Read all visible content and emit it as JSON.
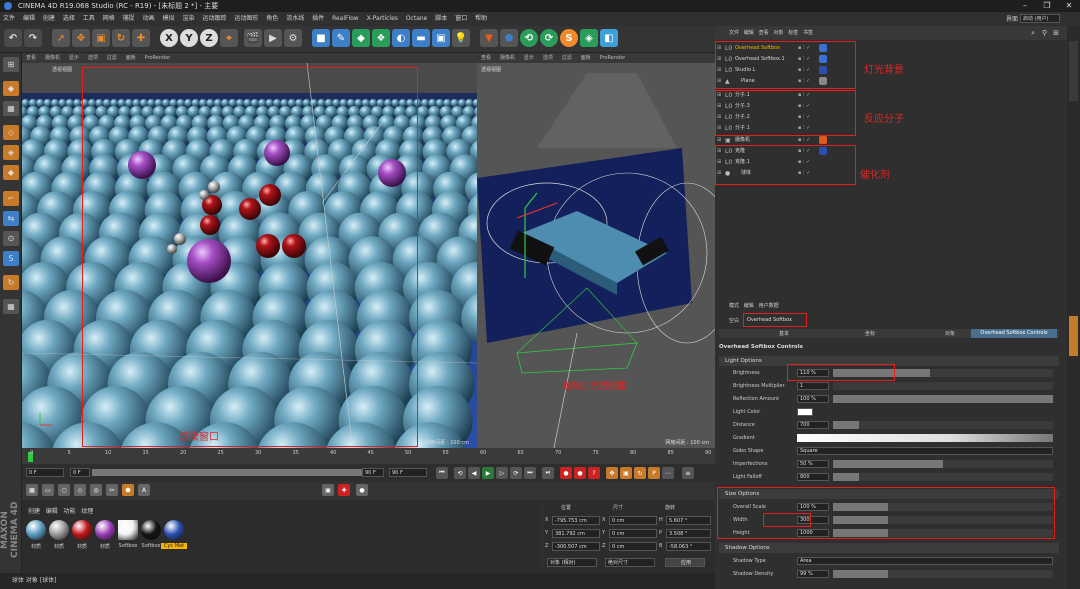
{
  "app": {
    "title": "CINEMA 4D R19.068 Studio (RC - R19) - [未标题 2 *] - 主要",
    "layout_label": "界面",
    "layout_value": "启动 (用户)"
  },
  "menu": [
    "文件",
    "编辑",
    "创建",
    "选择",
    "工具",
    "网格",
    "捕捉",
    "动画",
    "模拟",
    "渲染",
    "运动跟踪",
    "运动图形",
    "角色",
    "流水线",
    "插件",
    "RealFlow",
    "X-Particles",
    "Octane",
    "脚本",
    "窗口",
    "帮助"
  ],
  "viewport_left": {
    "menu": [
      "查看",
      "摄像机",
      "显示",
      "选项",
      "过滤",
      "面板",
      "ProRender"
    ],
    "name": "透视视图",
    "grid": "网格间距 : 100 cm",
    "annotation": "渲染窗口"
  },
  "viewport_right": {
    "menu": [
      "查看",
      "摄像机",
      "显示",
      "选项",
      "过滤",
      "面板",
      "ProRender"
    ],
    "name": "透视视图",
    "grid": "网格间距 : 100 cm",
    "annotation": "删除灯光跟随器"
  },
  "timeline": {
    "ticks": [
      "0",
      "5",
      "10",
      "15",
      "20",
      "25",
      "30",
      "35",
      "40",
      "45",
      "50",
      "55",
      "60",
      "65",
      "70",
      "75",
      "80",
      "85",
      "90"
    ],
    "frame_field": "0 F",
    "start_field": "0 F",
    "end_field": "90 F",
    "max_field": "90 F",
    "current": "0 F"
  },
  "materials": {
    "menu": [
      "创建",
      "编辑",
      "功能",
      "纹理"
    ],
    "items": [
      {
        "label": "材质",
        "color": "#5a9cc0"
      },
      {
        "label": "材质",
        "color": "#9a9a9a"
      },
      {
        "label": "材质",
        "color": "#c0141a"
      },
      {
        "label": "材质",
        "color": "#9a3fb8"
      },
      {
        "label": "Softbox",
        "color": "#f2f2f2"
      },
      {
        "label": "Softbox",
        "color": "#111111"
      },
      {
        "label": "Cyc Mat",
        "color": "#2a4fb0"
      }
    ]
  },
  "coords": {
    "headers": [
      "位置",
      "尺寸",
      "旋转"
    ],
    "rows": [
      {
        "axis": "X",
        "pos": "-795.753 cm",
        "size_axis": "X",
        "size": "0 cm",
        "rot_axis": "H",
        "rot": "5.607 °"
      },
      {
        "axis": "Y",
        "pos": "381.792 cm",
        "size_axis": "Y",
        "size": "0 cm",
        "rot_axis": "P",
        "rot": "3.508 °"
      },
      {
        "axis": "Z",
        "pos": "-300.507 cm",
        "size_axis": "Z",
        "size": "0 cm",
        "rot_axis": "B",
        "rot": "-58.063 °"
      }
    ],
    "mode1": "对象 (相对)",
    "mode2": "绝对尺寸",
    "apply": "应用"
  },
  "status": "球体 对象 [球体]",
  "object_manager": {
    "menu": [
      "文件",
      "编辑",
      "查看",
      "对象",
      "标签",
      "书签"
    ],
    "rows": [
      {
        "name": "Overhead Softbox",
        "icon": "L0",
        "highlight": true,
        "tag": "#3b6fd4"
      },
      {
        "name": "Overhead Softbox.1",
        "icon": "L0",
        "highlight": false,
        "tag": "#3b6fd4"
      },
      {
        "name": "Studio L",
        "icon": "L0",
        "highlight": false,
        "tag": "#2a4fb0"
      },
      {
        "name": "Plane",
        "icon": "▲",
        "highlight": false,
        "tag": "#888888"
      },
      {
        "name": "分子.1",
        "icon": "L0",
        "highlight": false,
        "tag": ""
      },
      {
        "name": "分子.3",
        "icon": "L0",
        "highlight": false,
        "tag": ""
      },
      {
        "name": "分子.2",
        "icon": "L0",
        "highlight": false,
        "tag": ""
      },
      {
        "name": "分子.1",
        "icon": "L0",
        "highlight": false,
        "tag": ""
      },
      {
        "name": "摄像机",
        "icon": "▣",
        "highlight": false,
        "tag": "#e05a1a"
      },
      {
        "name": "克隆",
        "icon": "L0",
        "highlight": false,
        "tag": "#2a4fb0"
      },
      {
        "name": "克隆.1",
        "icon": "L0",
        "highlight": false,
        "tag": ""
      },
      {
        "name": "球体",
        "icon": "●",
        "highlight": false,
        "tag": ""
      }
    ],
    "annotations": {
      "lights": "灯光背景",
      "molecules": "反应分子",
      "catalyst": "催化剂"
    }
  },
  "attribute_manager": {
    "menu": [
      "模式",
      "编辑",
      "用户数据"
    ],
    "object_type": "空白",
    "object_name": "Overhead Softbox",
    "tabs": [
      "基本",
      "坐标",
      "对象",
      "Overhead Softbox Controls"
    ],
    "section_title": "Overhead Softbox Controls",
    "light_options": "Light Options",
    "params": [
      {
        "label": "Brightness",
        "value": "110 %",
        "fill": 0.44
      },
      {
        "label": "Brightness Multiplier",
        "value": "1",
        "fill": 0.0
      },
      {
        "label": "Reflection Amount",
        "value": "100 %",
        "fill": 1.0
      },
      {
        "label": "Light Color",
        "value": "",
        "fill": 0.0
      },
      {
        "label": "Distance",
        "value": "700",
        "fill": 0.12
      },
      {
        "label": "Gradient",
        "value": "",
        "fill": 0.0
      },
      {
        "label": "Gobo Shape",
        "value": "Square",
        "fill": 0.0
      },
      {
        "label": "Imperfections",
        "value": "50 %",
        "fill": 0.5
      },
      {
        "label": "Light Falloff",
        "value": "800",
        "fill": 0.12
      }
    ],
    "size_options": "Size Options",
    "size_params": [
      {
        "label": "Overall Scale",
        "value": "100 %",
        "fill": 0.25
      },
      {
        "label": "Width",
        "value": "300",
        "fill": 0.25
      },
      {
        "label": "Height",
        "value": "1000",
        "fill": 0.25
      }
    ],
    "shadow_options": "Shadow Options",
    "shadow_params": [
      {
        "label": "Shadow Type",
        "value": "Area",
        "fill": 0.0
      },
      {
        "label": "Shadow Density",
        "value": "99 %",
        "fill": 0.25
      }
    ]
  }
}
